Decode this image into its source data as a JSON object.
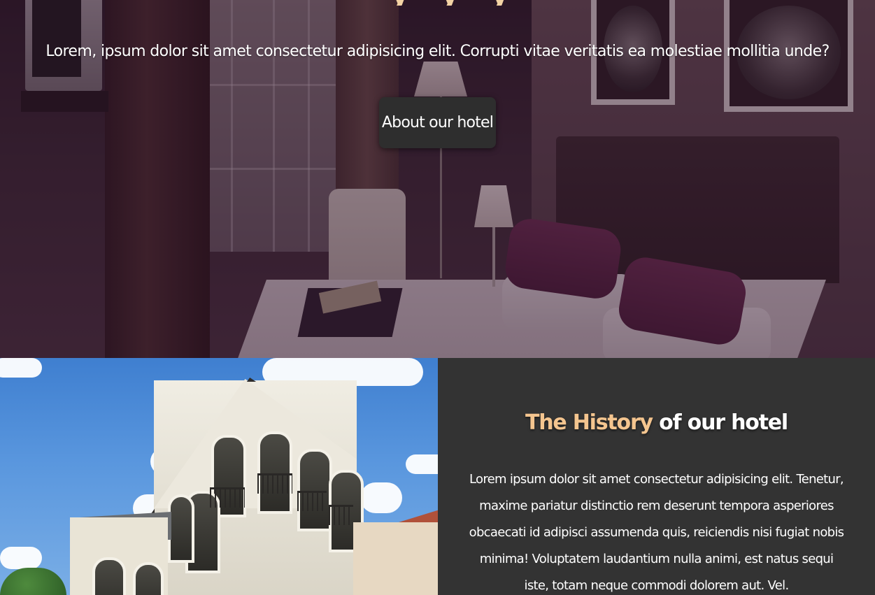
{
  "hero": {
    "title_fragment": "y y y",
    "subtitle": "Lorem, ipsum dolor sit amet consectetur adipisicing elit. Corrupti vitae veritatis ea molestiae mollitia unde?",
    "button_label": "About our hotel",
    "overlay_color": "#2d0f28"
  },
  "history": {
    "title_accent": "The History",
    "title_rest": " of our hotel",
    "body": "Lorem ipsum dolor sit amet consectetur adipisicing elit. Tenetur, maxime pariatur distinctio rem deserunt tempora asperiores obcaecati id adipisci assumenda quis, reiciendis nisi fugiat nobis minima! Voluptatem laudantium nulla animi, est natus sequi iste, totam neque commodi dolorem aut. Vel.",
    "accent_color": "#f4c58f",
    "panel_color": "#333333"
  },
  "images": {
    "hero_background": "hotel-bedroom-photo",
    "history_photo": "hotel-building-photo"
  }
}
